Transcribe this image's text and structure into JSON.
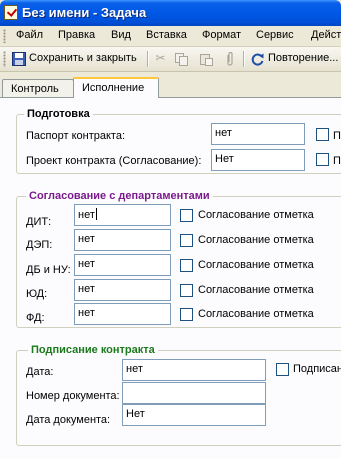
{
  "window": {
    "title": "Без имени - Задача"
  },
  "menu": [
    "Файл",
    "Правка",
    "Вид",
    "Вставка",
    "Формат",
    "Сервис",
    "Действ"
  ],
  "toolbar": {
    "save_close": "Сохранить и закрыть",
    "repeat": "Повторение..."
  },
  "tabs": [
    "Контроль",
    "Исполнение"
  ],
  "prep": {
    "title": "Подготовка",
    "passport_label": "Паспорт контракта:",
    "passport_value": "нет",
    "passport_check": "По",
    "project_label": "Проект контракта (Согласование):",
    "project_value": "Нет",
    "project_check": "По"
  },
  "approval": {
    "title": "Согласование с департаментами",
    "title_color": "#7a1a8c",
    "check_label": "Согласование отметка",
    "rows": [
      {
        "label": "ДИТ:",
        "value": "нет"
      },
      {
        "label": "ДЭП:",
        "value": "нет"
      },
      {
        "label": "ДБ и НУ:",
        "value": "нет"
      },
      {
        "label": "ЮД:",
        "value": "нет"
      },
      {
        "label": "ФД:",
        "value": "нет"
      }
    ]
  },
  "signing": {
    "title": "Подписание контракта",
    "title_color": "#1b7a1b",
    "date_label": "Дата:",
    "date_value": "нет",
    "date_check": "Подписан",
    "docnum_label": "Номер документа:",
    "docnum_value": "",
    "docdate_label": "Дата документа:",
    "docdate_value": "Нет"
  }
}
